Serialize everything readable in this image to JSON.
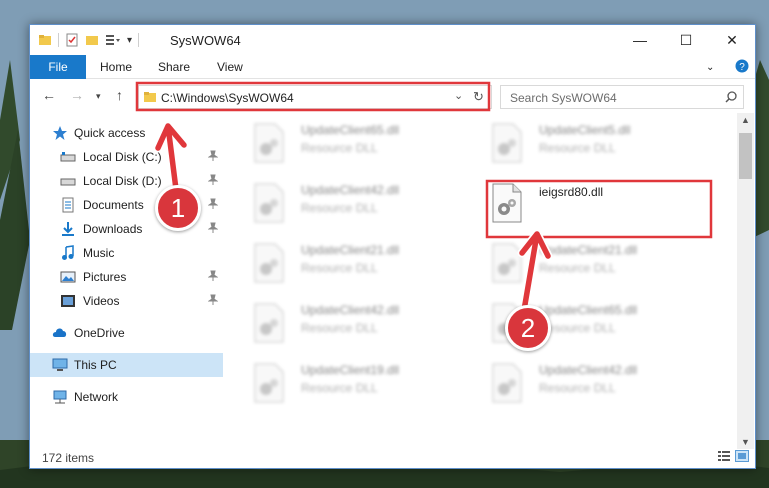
{
  "window": {
    "title": "SysWOW64"
  },
  "ribbon": {
    "tabs": [
      {
        "label": "File"
      },
      {
        "label": "Home"
      },
      {
        "label": "Share"
      },
      {
        "label": "View"
      }
    ]
  },
  "address": {
    "path": "C:\\Windows\\SysWOW64"
  },
  "search": {
    "placeholder": "Search SysWOW64"
  },
  "nav": {
    "quick_access": "Quick access",
    "items": [
      {
        "label": "Local Disk (C:)",
        "icon": "drive-icon"
      },
      {
        "label": "Local Disk (D:)",
        "icon": "drive-icon"
      },
      {
        "label": "Documents",
        "icon": "documents-icon"
      },
      {
        "label": "Downloads",
        "icon": "downloads-icon"
      },
      {
        "label": "Music",
        "icon": "music-icon"
      },
      {
        "label": "Pictures",
        "icon": "pictures-icon"
      },
      {
        "label": "Videos",
        "icon": "videos-icon"
      }
    ],
    "onedrive": "OneDrive",
    "this_pc": "This PC",
    "network": "Network"
  },
  "files": [
    {
      "name": "UpdateClient65.dll",
      "type": "Resource DLL"
    },
    {
      "name": "UpdateClient5.dll",
      "type": "Resource DLL"
    },
    {
      "name": "UpdateClient42.dll",
      "type": "Resource DLL"
    },
    {
      "name": "ieigsrd80.dll",
      "type": ""
    },
    {
      "name": "UpdateClient21.dll",
      "type": "Resource DLL"
    },
    {
      "name": "UpdateClient21.dll",
      "type": "Resource DLL"
    },
    {
      "name": "UpdateClient42.dll",
      "type": "Resource DLL"
    },
    {
      "name": "UpdateClient65.dll",
      "type": "Resource DLL"
    },
    {
      "name": "UpdateClient19.dll",
      "type": "Resource DLL"
    },
    {
      "name": "UpdateClient42.dll",
      "type": "Resource DLL"
    }
  ],
  "status": {
    "item_count": "172 items"
  },
  "annotations": {
    "step1": "1",
    "step2": "2",
    "color": "#e0373b"
  },
  "colors": {
    "accent": "#1979ca",
    "selected": "#cce4f7"
  }
}
